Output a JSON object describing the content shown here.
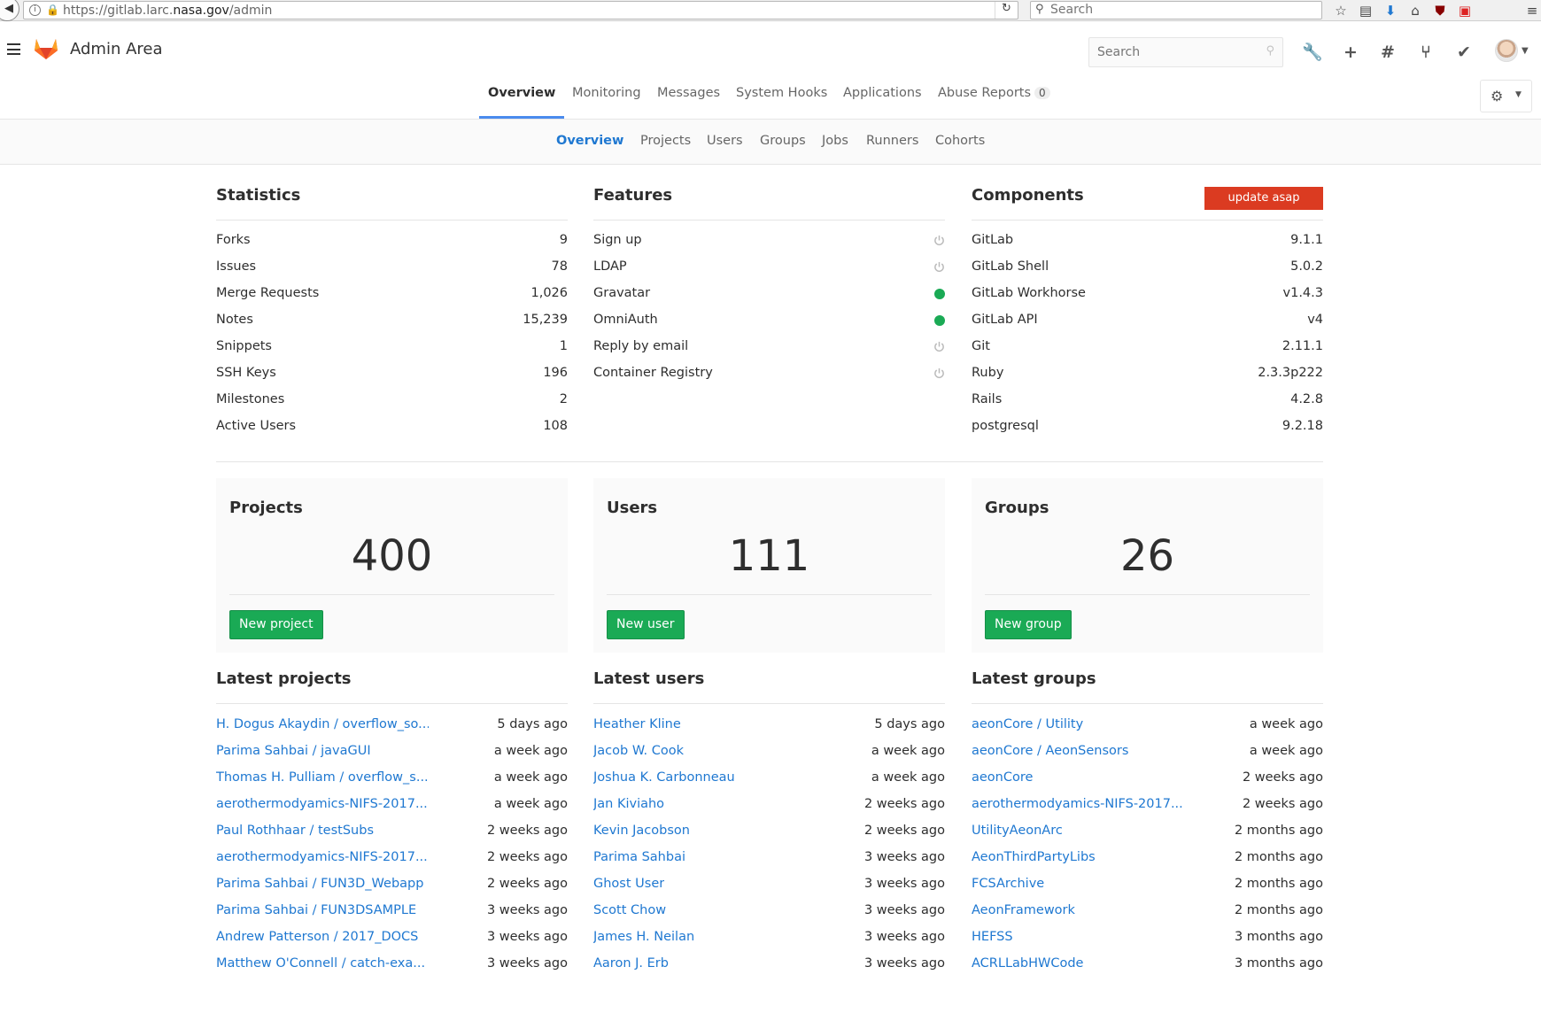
{
  "browser": {
    "url_prefix": "https://gitlab.larc.",
    "url_domain": "nasa.gov",
    "url_path": "/admin",
    "search_placeholder": "Search"
  },
  "header": {
    "title": "Admin Area",
    "search_placeholder": "Search"
  },
  "primary_nav": {
    "tabs": [
      {
        "label": "Overview",
        "active": true
      },
      {
        "label": "Monitoring"
      },
      {
        "label": "Messages"
      },
      {
        "label": "System Hooks"
      },
      {
        "label": "Applications"
      },
      {
        "label": "Abuse Reports",
        "badge": "0"
      }
    ]
  },
  "sub_nav": {
    "tabs": [
      {
        "label": "Overview",
        "active": true
      },
      {
        "label": "Projects"
      },
      {
        "label": "Users"
      },
      {
        "label": "Groups"
      },
      {
        "label": "Jobs"
      },
      {
        "label": "Runners"
      },
      {
        "label": "Cohorts"
      }
    ]
  },
  "statistics": {
    "title": "Statistics",
    "rows": [
      {
        "label": "Forks",
        "value": "9"
      },
      {
        "label": "Issues",
        "value": "78"
      },
      {
        "label": "Merge Requests",
        "value": "1,026"
      },
      {
        "label": "Notes",
        "value": "15,239"
      },
      {
        "label": "Snippets",
        "value": "1"
      },
      {
        "label": "SSH Keys",
        "value": "196"
      },
      {
        "label": "Milestones",
        "value": "2"
      },
      {
        "label": "Active Users",
        "value": "108"
      }
    ]
  },
  "features": {
    "title": "Features",
    "rows": [
      {
        "label": "Sign up",
        "enabled": false
      },
      {
        "label": "LDAP",
        "enabled": false
      },
      {
        "label": "Gravatar",
        "enabled": true
      },
      {
        "label": "OmniAuth",
        "enabled": true
      },
      {
        "label": "Reply by email",
        "enabled": false
      },
      {
        "label": "Container Registry",
        "enabled": false
      }
    ]
  },
  "components": {
    "title": "Components",
    "update_label": "update asap",
    "rows": [
      {
        "label": "GitLab",
        "value": "9.1.1"
      },
      {
        "label": "GitLab Shell",
        "value": "5.0.2"
      },
      {
        "label": "GitLab Workhorse",
        "value": "v1.4.3"
      },
      {
        "label": "GitLab API",
        "value": "v4"
      },
      {
        "label": "Git",
        "value": "2.11.1"
      },
      {
        "label": "Ruby",
        "value": "2.3.3p222"
      },
      {
        "label": "Rails",
        "value": "4.2.8"
      },
      {
        "label": "postgresql",
        "value": "9.2.18"
      }
    ]
  },
  "cards": {
    "projects": {
      "title": "Projects",
      "count": "400",
      "button": "New project"
    },
    "users": {
      "title": "Users",
      "count": "111",
      "button": "New user"
    },
    "groups": {
      "title": "Groups",
      "count": "26",
      "button": "New group"
    }
  },
  "latest_projects": {
    "title": "Latest projects",
    "items": [
      {
        "name": "H. Dogus Akaydin / overflow_so...",
        "when": "5 days ago"
      },
      {
        "name": "Parima Sahbai / javaGUI",
        "when": "a week ago"
      },
      {
        "name": "Thomas H. Pulliam / overflow_s...",
        "when": "a week ago"
      },
      {
        "name": "aerothermodyamics-NIFS-2017...",
        "when": "a week ago"
      },
      {
        "name": "Paul Rothhaar / testSubs",
        "when": "2 weeks ago"
      },
      {
        "name": "aerothermodyamics-NIFS-2017...",
        "when": "2 weeks ago"
      },
      {
        "name": "Parima Sahbai / FUN3D_Webapp",
        "when": "2 weeks ago"
      },
      {
        "name": "Parima Sahbai / FUN3DSAMPLE",
        "when": "3 weeks ago"
      },
      {
        "name": "Andrew Patterson / 2017_DOCS",
        "when": "3 weeks ago"
      },
      {
        "name": "Matthew O'Connell / catch-exa...",
        "when": "3 weeks ago"
      }
    ]
  },
  "latest_users": {
    "title": "Latest users",
    "items": [
      {
        "name": "Heather Kline",
        "when": "5 days ago"
      },
      {
        "name": "Jacob W. Cook",
        "when": "a week ago"
      },
      {
        "name": "Joshua K. Carbonneau",
        "when": "a week ago"
      },
      {
        "name": "Jan Kiviaho",
        "when": "2 weeks ago"
      },
      {
        "name": "Kevin Jacobson",
        "when": "2 weeks ago"
      },
      {
        "name": "Parima Sahbai",
        "when": "3 weeks ago"
      },
      {
        "name": "Ghost User",
        "when": "3 weeks ago"
      },
      {
        "name": "Scott Chow",
        "when": "3 weeks ago"
      },
      {
        "name": "James H. Neilan",
        "when": "3 weeks ago"
      },
      {
        "name": "Aaron J. Erb",
        "when": "3 weeks ago"
      }
    ]
  },
  "latest_groups": {
    "title": "Latest groups",
    "items": [
      {
        "name": "aeonCore / Utility",
        "when": "a week ago"
      },
      {
        "name": "aeonCore / AeonSensors",
        "when": "a week ago"
      },
      {
        "name": "aeonCore",
        "when": "2 weeks ago"
      },
      {
        "name": "aerothermodyamics-NIFS-2017...",
        "when": "2 weeks ago"
      },
      {
        "name": "UtilityAeonArc",
        "when": "2 months ago"
      },
      {
        "name": "AeonThirdPartyLibs",
        "when": "2 months ago"
      },
      {
        "name": "FCSArchive",
        "when": "2 months ago"
      },
      {
        "name": "AeonFramework",
        "when": "2 months ago"
      },
      {
        "name": "HEFSS",
        "when": "3 months ago"
      },
      {
        "name": "ACRLLabHWCode",
        "when": "3 months ago"
      }
    ]
  },
  "colors": {
    "link": "#1f78d1",
    "success": "#1aaa55",
    "danger": "#db3b21",
    "active_tab_underline": "#4a8bee"
  }
}
